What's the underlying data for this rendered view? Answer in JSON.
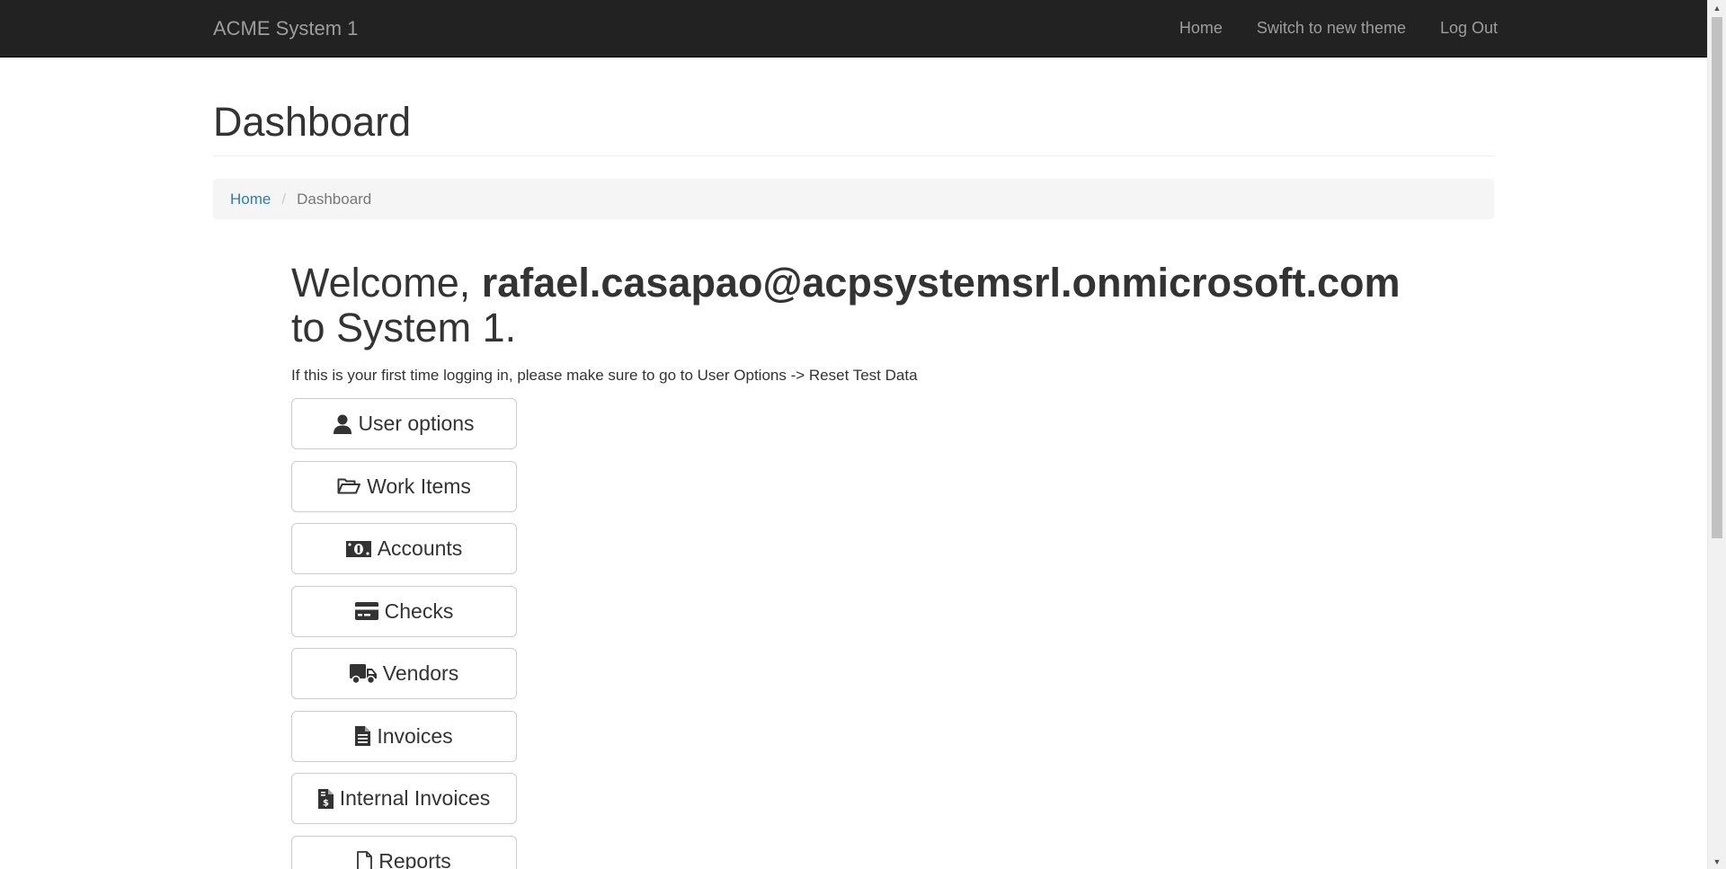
{
  "navbar": {
    "brand": "ACME System 1",
    "links": [
      "Home",
      "Switch to new theme",
      "Log Out"
    ]
  },
  "page": {
    "title": "Dashboard"
  },
  "breadcrumb": {
    "home": "Home",
    "current": "Dashboard"
  },
  "welcome": {
    "prefix": "Welcome,",
    "user": "rafael.casapao@acpsystemsrl.onmicrosoft.com",
    "suffix": "to System 1."
  },
  "notice": "If this is your first time logging in, please make sure to go to User Options -> Reset Test Data",
  "buttons": [
    {
      "label": "User options",
      "icon": "user-icon"
    },
    {
      "label": "Work Items",
      "icon": "folder-open-icon"
    },
    {
      "label": "Accounts",
      "icon": "money-bill-icon"
    },
    {
      "label": "Checks",
      "icon": "credit-card-icon"
    },
    {
      "label": "Vendors",
      "icon": "truck-icon"
    },
    {
      "label": "Invoices",
      "icon": "file-text-icon"
    },
    {
      "label": "Internal Invoices",
      "icon": "file-invoice-dollar-icon"
    },
    {
      "label": "Reports",
      "icon": "file-icon"
    }
  ]
}
